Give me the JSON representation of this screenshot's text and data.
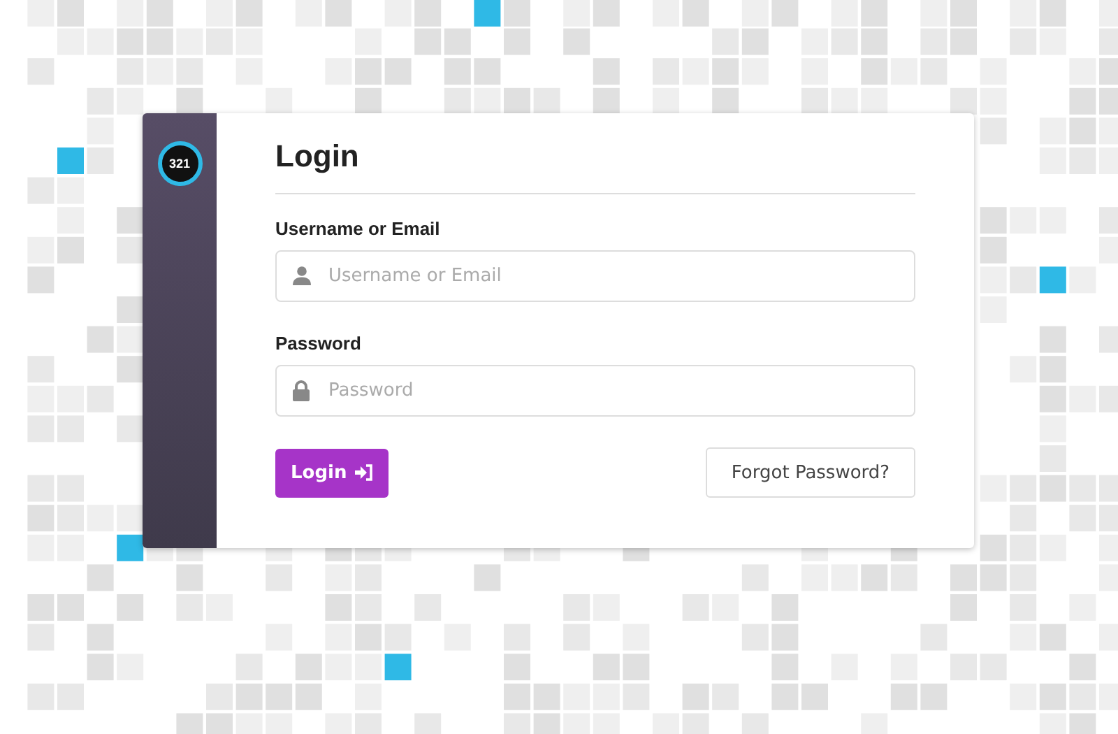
{
  "logo": {
    "text": "321"
  },
  "title": "Login",
  "fields": [
    {
      "kind": "user",
      "label": "Username or Email",
      "placeholder": "Username or Email"
    },
    {
      "kind": "lock",
      "label": "Password",
      "placeholder": "Password"
    }
  ],
  "login_button": {
    "label": "Login"
  },
  "forgot_button": {
    "label": "Forgot Password?"
  }
}
